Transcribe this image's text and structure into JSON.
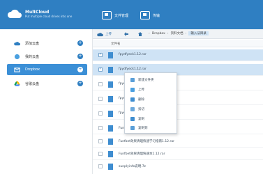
{
  "app": {
    "title": "MultCloud",
    "tagline": "Put multiple cloud drives into one"
  },
  "top_buttons": [
    {
      "label": "文件管理"
    },
    {
      "label": "传输"
    }
  ],
  "sidebar": {
    "items": [
      {
        "label": "添加云盘",
        "icon": "cloud-icon",
        "active": false
      },
      {
        "label": "我的云盘",
        "icon": "drive-icon",
        "active": false
      },
      {
        "label": "Dropbox",
        "icon": "dropbox-icon",
        "active": true
      },
      {
        "label": "谷歌云盘",
        "icon": "google-drive-icon",
        "active": false
      }
    ],
    "dot_label": "+"
  },
  "toolbar": {
    "upload_label": "上传",
    "breadcrumb": [
      "Dropbox",
      "资料文档",
      "输入法目录"
    ]
  },
  "file_list": {
    "column_header": "文件名",
    "rows": [
      {
        "name": "fpydfyeck1.12.rar",
        "selected": true
      },
      {
        "name": "fpydfyeck1.12.rar",
        "selected": true
      },
      {
        "name": "fpyd",
        "selected": false
      },
      {
        "name": "fpyd",
        "selected": false
      },
      {
        "name": "fpyd",
        "selected": false
      },
      {
        "name": "Funfbet效果清理快速学习指南1.12.rar",
        "selected": false
      },
      {
        "name": "Funfbet效果清理快速学习指南1.12.rar",
        "selected": false
      },
      {
        "name": "Funfbet效果清理快速本1.12.rar",
        "selected": false
      },
      {
        "name": "sunplyinfo说明.7z",
        "selected": false
      }
    ]
  },
  "context_menu": {
    "items": [
      {
        "label": "新建文件夹",
        "icon": "new-folder-icon"
      },
      {
        "label": "上传",
        "icon": "upload-icon"
      },
      {
        "label": "删除",
        "icon": "delete-icon"
      },
      {
        "label": "剪切",
        "icon": "cut-icon"
      },
      {
        "label": "复制",
        "icon": "copy-icon"
      },
      {
        "label": "复制到",
        "icon": "copy-to-icon"
      }
    ]
  },
  "colors": {
    "brand": "#2f7fc2",
    "selection": "#cfe3f5",
    "file_icon": "#3e8dd0"
  }
}
